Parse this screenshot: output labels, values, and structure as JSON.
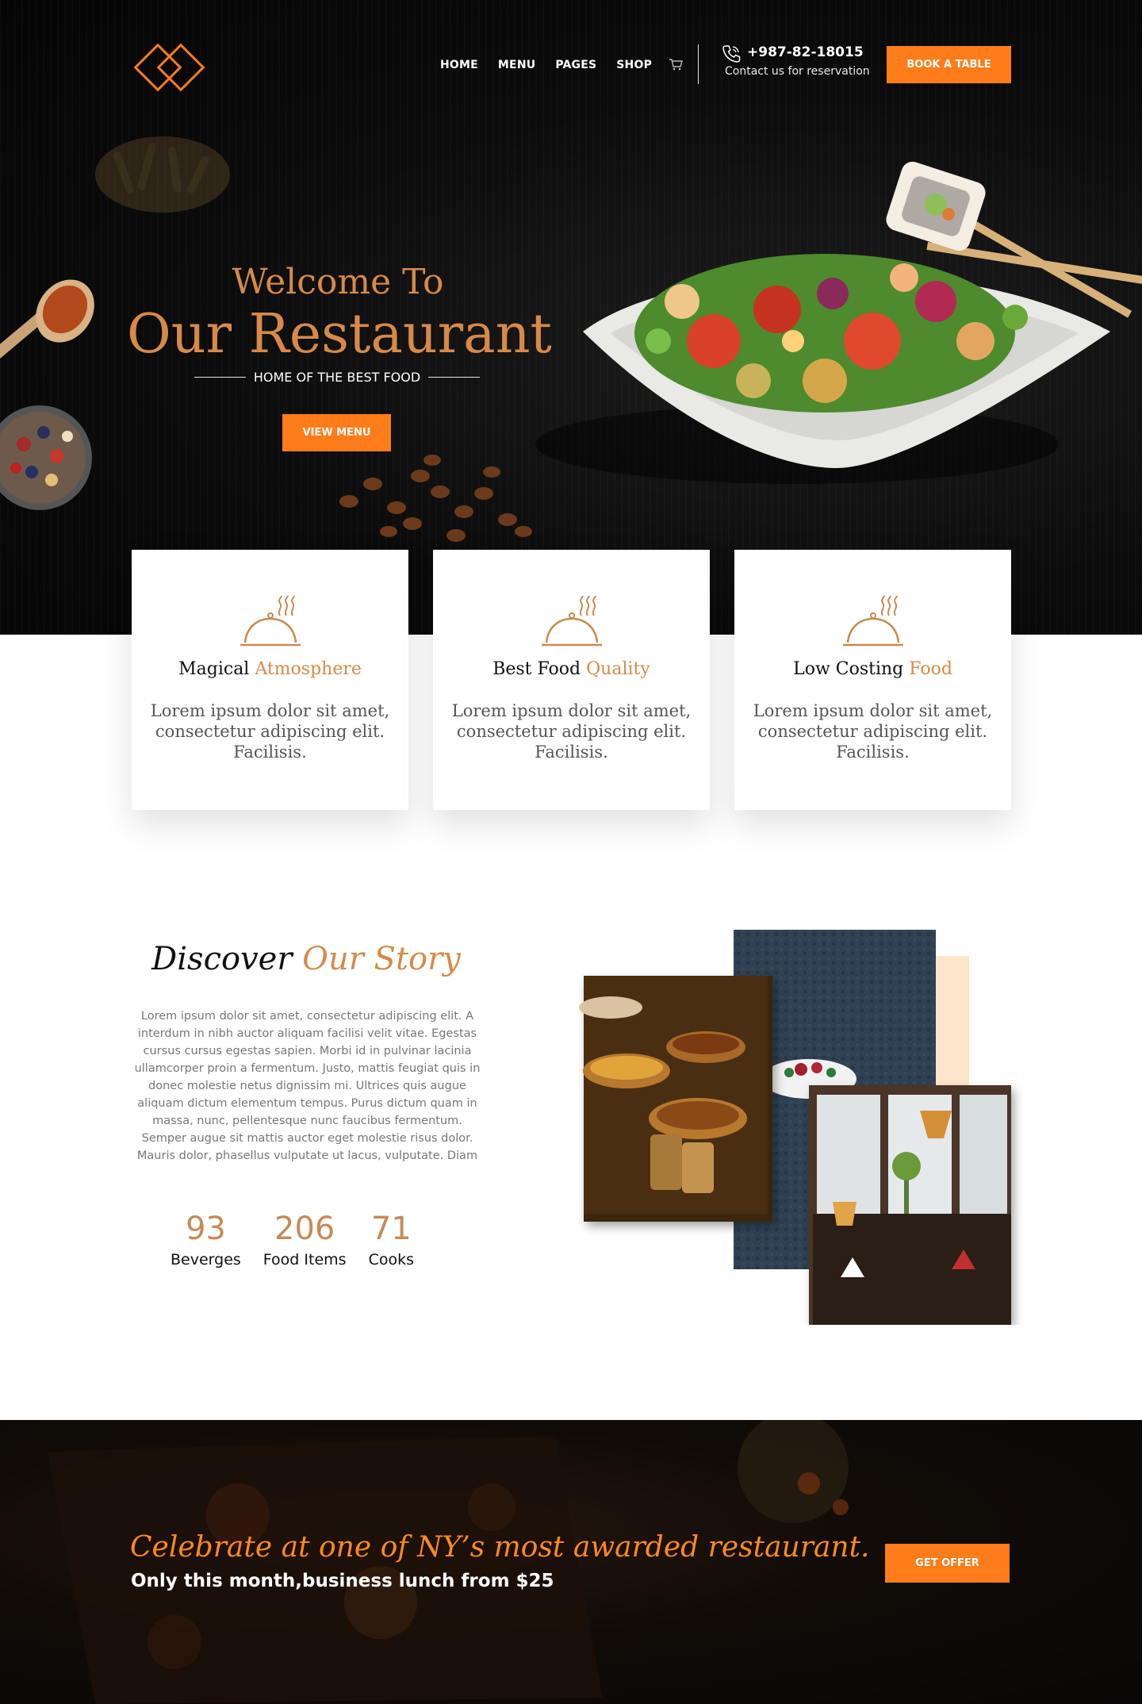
{
  "brand": {
    "accent": "#ff7c1a",
    "gold": "#d78a47",
    "logo_icon": "diamond-logo-icon"
  },
  "nav": {
    "items": [
      {
        "label": "HOME"
      },
      {
        "label": "MENU"
      },
      {
        "label": "PAGES"
      },
      {
        "label": "SHOP"
      }
    ],
    "cart_icon": "cart-icon",
    "phone_icon": "phone-icon",
    "phone_number": "+987-82-18015",
    "phone_caption": "Contact us for reservation",
    "book_label": "BOOK A TABLE"
  },
  "hero": {
    "welcome": "Welcome To",
    "title": "Our Restaurant",
    "tagline": "HOME OF THE BEST FOOD",
    "cta_label": "VIEW MENU"
  },
  "features": [
    {
      "icon": "serving-cloche-icon",
      "title_plain": "Magical ",
      "title_accent": "Atmosphere",
      "text": "Lorem ipsum dolor sit amet, consectetur adipiscing elit. Facilisis."
    },
    {
      "icon": "serving-cloche-icon",
      "title_plain": "Best Food ",
      "title_accent": "Quality",
      "text": "Lorem ipsum dolor sit amet, consectetur adipiscing elit. Facilisis."
    },
    {
      "icon": "serving-cloche-icon",
      "title_plain": "Low Costing ",
      "title_accent": "Food",
      "text": "Lorem ipsum dolor sit amet, consectetur adipiscing elit. Facilisis."
    }
  ],
  "story": {
    "title_plain": "Discover ",
    "title_accent": "Our Story",
    "body": "Lorem ipsum dolor sit amet, consectetur adipiscing elit. A interdum in nibh auctor aliquam facilisi velit vitae. Egestas cursus cursus egestas sapien. Morbi id in pulvinar lacinia ullamcorper proin a fermentum. Justo, mattis feugiat quis in donec molestie netus dignissim mi. Ultrices quis augue aliquam dictum elementum tempus. Purus dictum quam in massa, nunc, pellentesque nunc faucibus fermentum. Semper augue sit mattis auctor eget molestie risus dolor. Mauris dolor, phasellus vulputate ut lacus, vulputate. Diam",
    "stats": [
      {
        "value": "93",
        "label": "Beverges"
      },
      {
        "value": "206",
        "label": "Food Items"
      },
      {
        "value": "71",
        "label": "Cooks"
      }
    ]
  },
  "offer": {
    "title": "Celebrate at one of NY’s most awarded restaurant.",
    "subtitle": "Only this month,business lunch from $25",
    "cta_label": "GET OFFER"
  }
}
